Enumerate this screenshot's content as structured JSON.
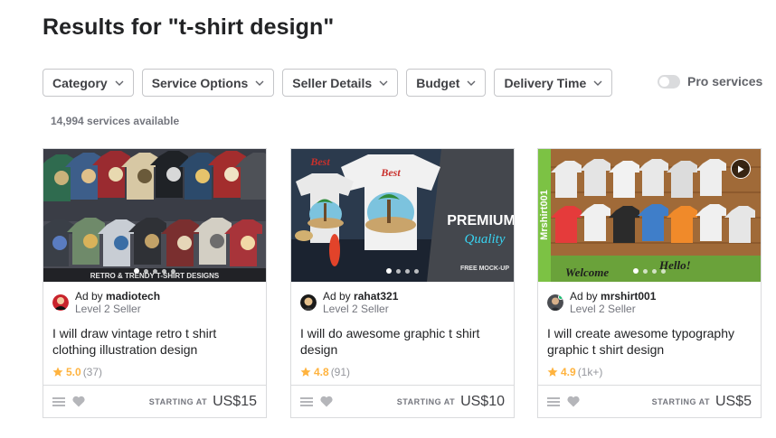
{
  "page": {
    "title": "Results for \"t-shirt design\"",
    "services_count": "14,994 services available"
  },
  "filters": [
    {
      "label": "Category"
    },
    {
      "label": "Service Options"
    },
    {
      "label": "Seller Details"
    },
    {
      "label": "Budget"
    },
    {
      "label": "Delivery Time"
    }
  ],
  "pro_toggle": {
    "label": "Pro services",
    "enabled": false
  },
  "gigs": [
    {
      "ad_prefix": "Ad by",
      "seller": "madiotech",
      "level": "Level 2 Seller",
      "title": "I will draw vintage retro t shirt clothing illustration design",
      "rating": "5.0",
      "reviews": "(37)",
      "starting_label": "STARTING AT",
      "price": "US$15",
      "image_caption": "RETRO & TRENDY T-SHIRT DESIGNS",
      "slides": 5,
      "active_slide": 0,
      "has_video": false,
      "online": false
    },
    {
      "ad_prefix": "Ad by",
      "seller": "rahat321",
      "level": "Level 2 Seller",
      "title": "I will do awesome graphic t shirt design",
      "rating": "4.8",
      "reviews": "(91)",
      "starting_label": "STARTING AT",
      "price": "US$10",
      "image_caption": "PREMIUM",
      "image_caption2": "Quality",
      "image_caption3": "FREE MOCK-UP",
      "slides": 4,
      "active_slide": 0,
      "has_video": false,
      "online": false
    },
    {
      "ad_prefix": "Ad by",
      "seller": "mrshirt001",
      "level": "Level 2 Seller",
      "title": "I will create awesome typography graphic t shirt design",
      "rating": "4.9",
      "reviews": "(1k+)",
      "starting_label": "STARTING AT",
      "price": "US$5",
      "image_caption": "Mrshirt001",
      "slides": 4,
      "active_slide": 0,
      "has_video": true,
      "online": true
    }
  ],
  "colors": {
    "accent_green": "#1dbf73",
    "star": "#ffb33e",
    "text_dark": "#222325",
    "text_muted": "#74767e",
    "border": "#dadbdd"
  }
}
